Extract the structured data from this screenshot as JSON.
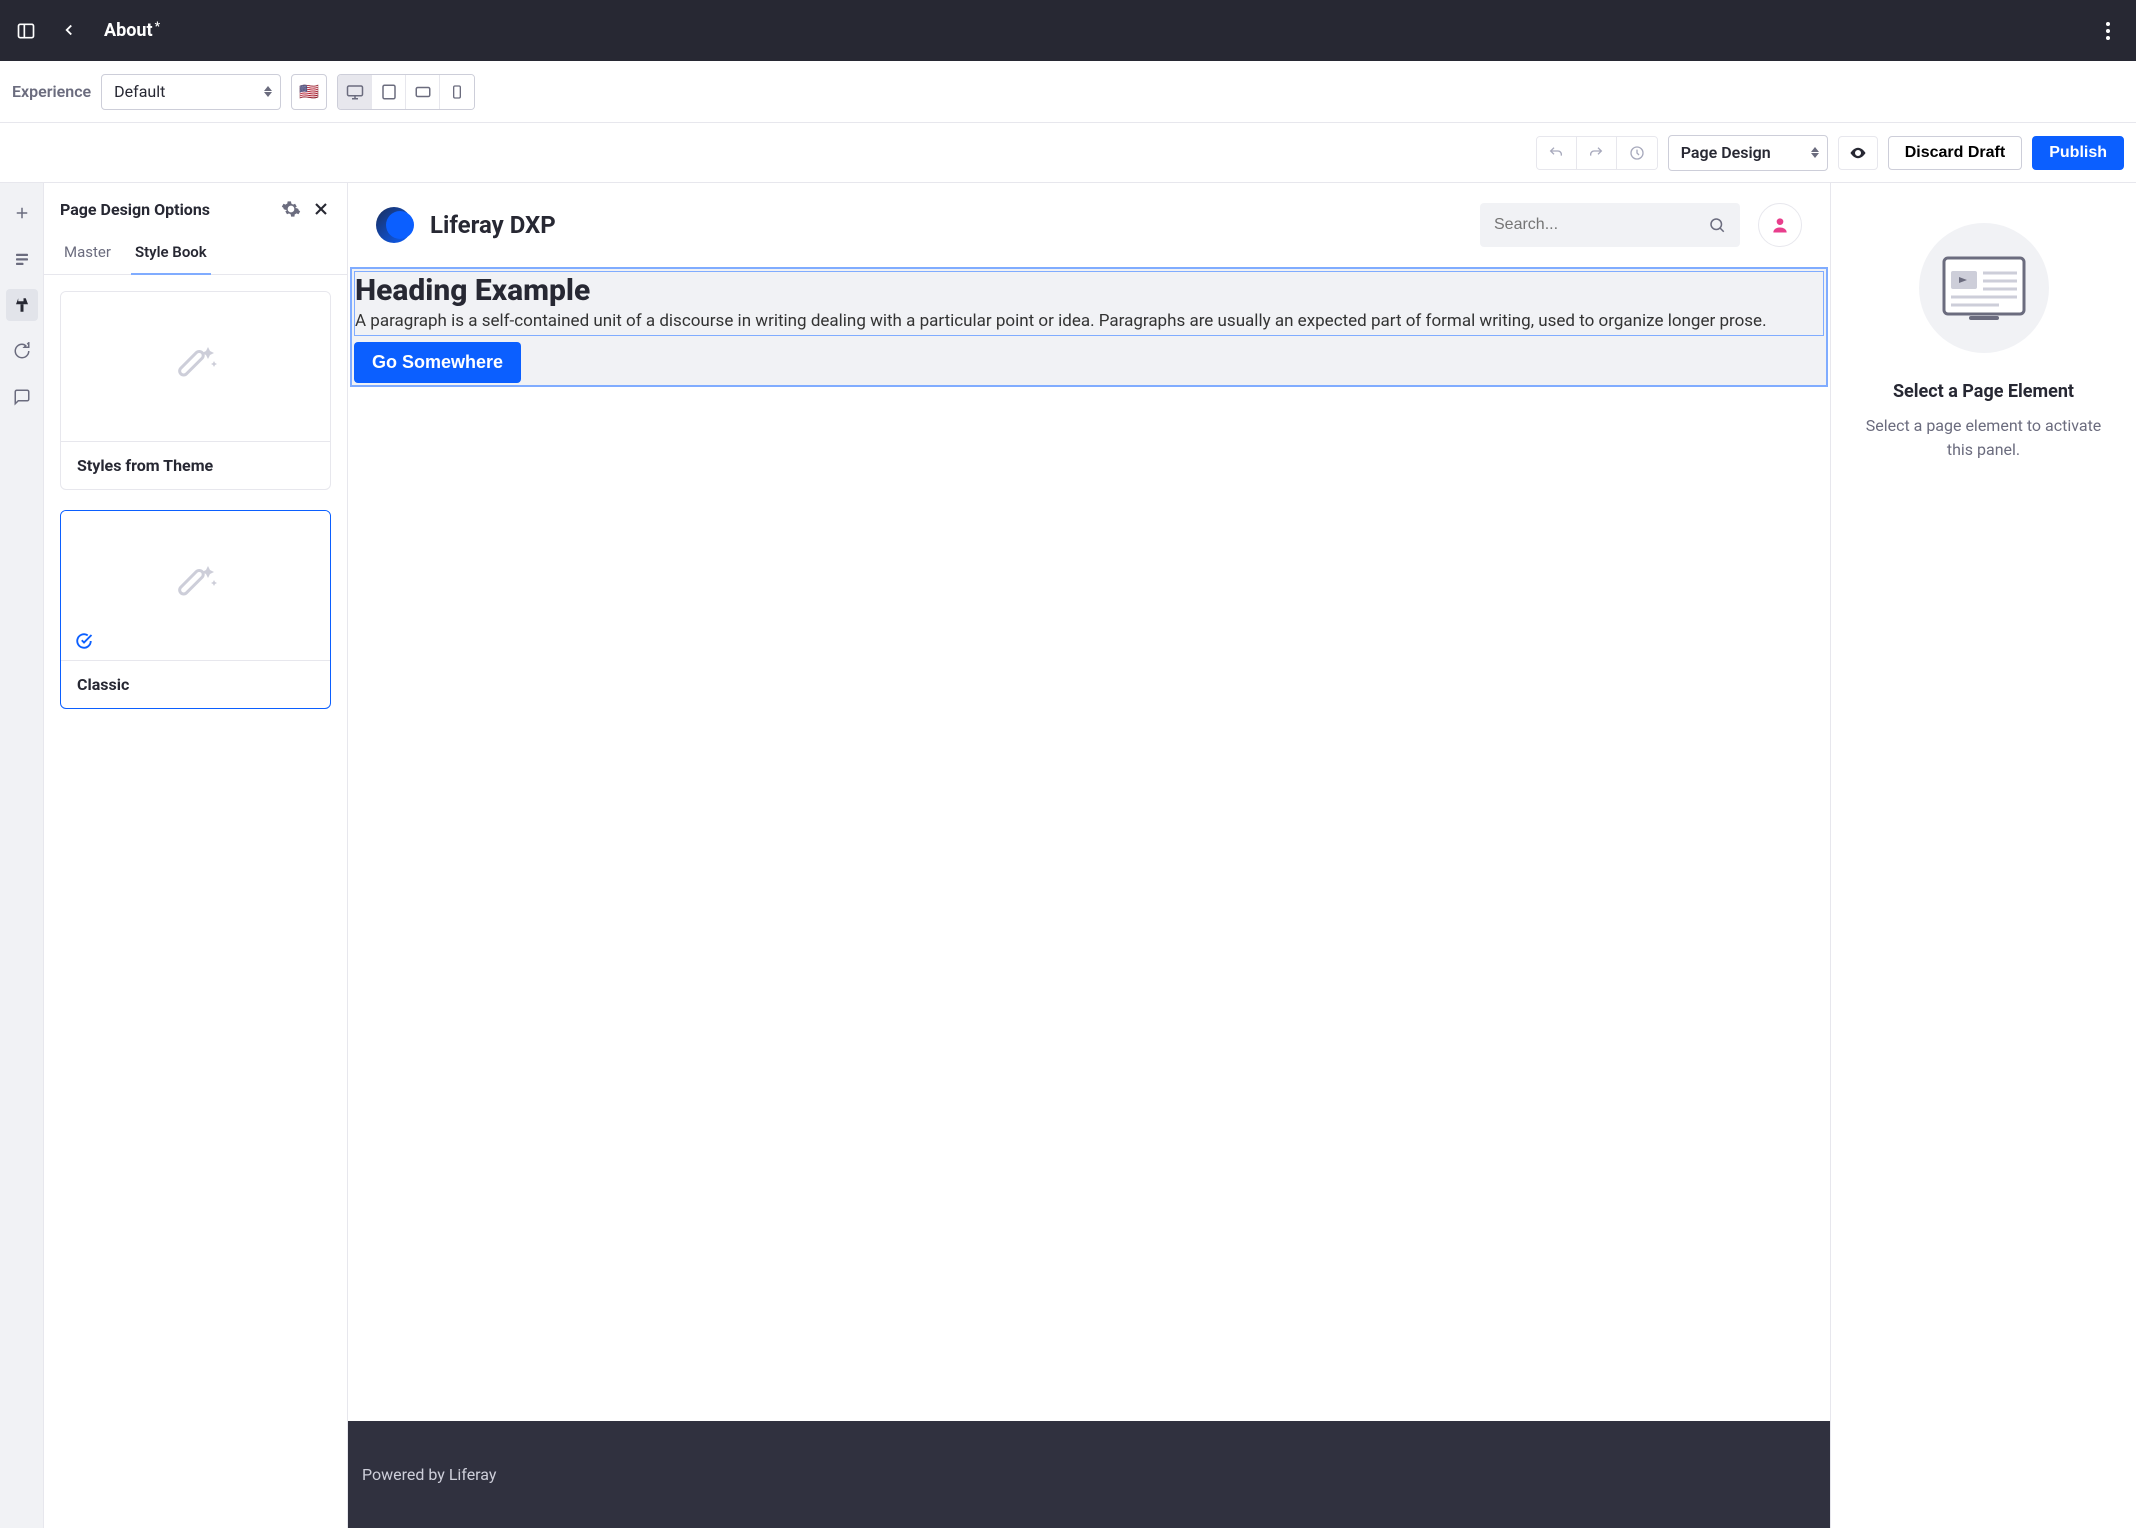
{
  "header": {
    "title": "About"
  },
  "experience": {
    "label": "Experience",
    "selected": "Default"
  },
  "toolbar": {
    "mode": "Page Design",
    "discard": "Discard Draft",
    "publish": "Publish"
  },
  "sidePanel": {
    "title": "Page Design Options",
    "tabs": [
      "Master",
      "Style Book"
    ],
    "activeTab": 1,
    "cards": [
      {
        "label": "Styles from Theme",
        "selected": false
      },
      {
        "label": "Classic",
        "selected": true
      }
    ]
  },
  "canvas": {
    "siteTitle": "Liferay DXP",
    "searchPlaceholder": "Search...",
    "heading": "Heading Example",
    "paragraph": "A paragraph is a self-contained unit of a discourse in writing dealing with a particular point or idea. Paragraphs are usually an expected part of formal writing, used to organize longer prose.",
    "buttonLabel": "Go Somewhere",
    "footer": "Powered by Liferay"
  },
  "rightPanel": {
    "title": "Select a Page Element",
    "subtitle": "Select a page element to activate this panel."
  }
}
